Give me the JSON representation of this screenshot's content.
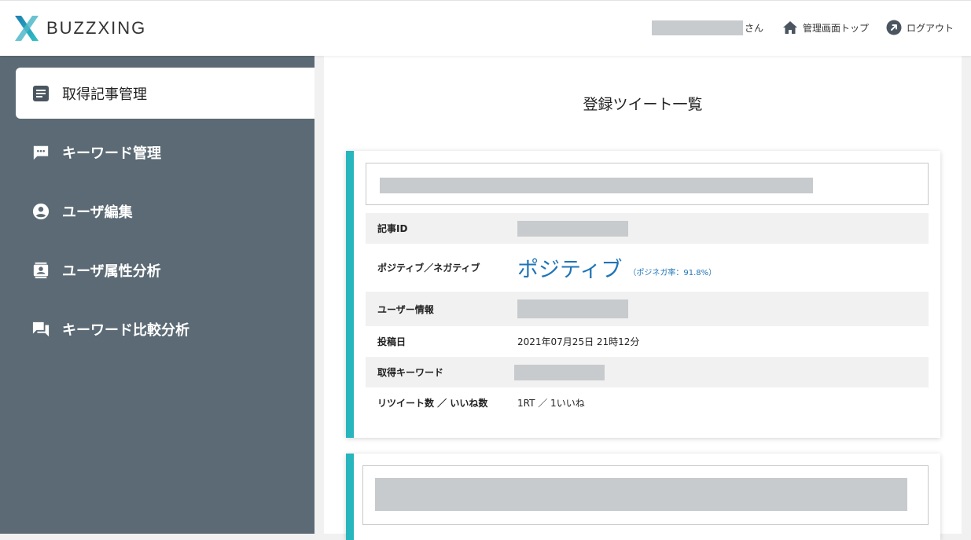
{
  "header": {
    "logo_text": "BUZZXING",
    "user_suffix": "さん",
    "admin_top_label": "管理画面トップ",
    "logout_label": "ログアウト"
  },
  "sidebar": {
    "items": [
      {
        "label": "取得記事管理",
        "icon": "article-icon",
        "active": true
      },
      {
        "label": "キーワード管理",
        "icon": "chat-dots-icon",
        "active": false
      },
      {
        "label": "ユーザ編集",
        "icon": "user-circle-icon",
        "active": false
      },
      {
        "label": "ユーザ属性分析",
        "icon": "contact-card-icon",
        "active": false
      },
      {
        "label": "キーワード比較分析",
        "icon": "forum-icon",
        "active": false
      }
    ]
  },
  "main": {
    "title": "登録ツイート一覧",
    "card": {
      "rows": [
        {
          "label": "記事ID"
        },
        {
          "label": "ポジティブ／ネガティブ",
          "value": "ポジティブ",
          "sub": "（ポジネガ率：91.8%）"
        },
        {
          "label": "ユーザー情報"
        },
        {
          "label": "投稿日",
          "value": "2021年07月25日 21時12分"
        },
        {
          "label": "取得キーワード"
        },
        {
          "label": "リツイート数 ／ いいね数",
          "value": "1RT ／ 1いいね"
        }
      ]
    }
  },
  "colors": {
    "accent": "#27b5be",
    "sidebar_bg": "#5b6a74",
    "positive": "#1f74b6",
    "redaction": "#c8cbcd"
  }
}
